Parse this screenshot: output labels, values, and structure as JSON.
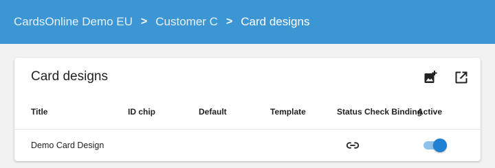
{
  "breadcrumb": {
    "items": [
      "CardsOnline Demo EU",
      "Customer C",
      "Card designs"
    ],
    "separator": ">"
  },
  "card": {
    "title": "Card designs",
    "actions": [
      {
        "name": "add-image-icon"
      },
      {
        "name": "open-external-icon"
      }
    ]
  },
  "table": {
    "columns": [
      "Title",
      "ID chip",
      "Default",
      "Template",
      "Status Check Binding",
      "Active"
    ],
    "rows": [
      {
        "title": "Demo Card Design",
        "id_chip": "",
        "default": "",
        "template": "",
        "status_check_binding_icon": "link-icon",
        "active": true
      }
    ]
  },
  "colors": {
    "header_bg": "#3d96d4",
    "toggle_on": "#1f7fd1",
    "toggle_track": "#8cc3ec"
  }
}
